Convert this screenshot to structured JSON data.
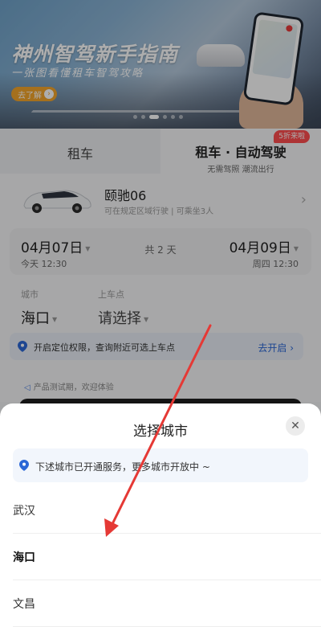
{
  "banner": {
    "title": "神州智驾新手指南",
    "subtitle": "一张图看懂租车智驾攻略",
    "button_label": "去了解"
  },
  "tabs": {
    "left_label": "租车",
    "right_label": "租车 · 自动驾驶",
    "right_sub": "无需驾照 潮流出行",
    "badge": "5折来啦"
  },
  "vehicle": {
    "name": "颐驰06",
    "desc": "可在规定区域行驶 | 可乘坐3人"
  },
  "dates": {
    "pickup_date": "04月07日",
    "pickup_time": "今天 12:30",
    "duration": "共 2 天",
    "return_date": "04月09日",
    "return_time": "周四 12:30"
  },
  "location": {
    "city_label": "城市",
    "city_value": "海口",
    "pickup_label": "上车点",
    "pickup_placeholder": "请选择"
  },
  "permission": {
    "text": "开启定位权限，查询附近可选上车点",
    "action": "去开启"
  },
  "beta_notice": "产品测试期，欢迎体验",
  "city_sheet": {
    "title": "选择城市",
    "notice": "下述城市已开通服务，更多城市开放中 ~",
    "cities": [
      "武汉",
      "海口",
      "文昌"
    ],
    "selected": "海口"
  },
  "colors": {
    "accent_blue": "#2b67d6",
    "badge_red": "#ff4d4f",
    "arrow_red": "#e53935"
  }
}
